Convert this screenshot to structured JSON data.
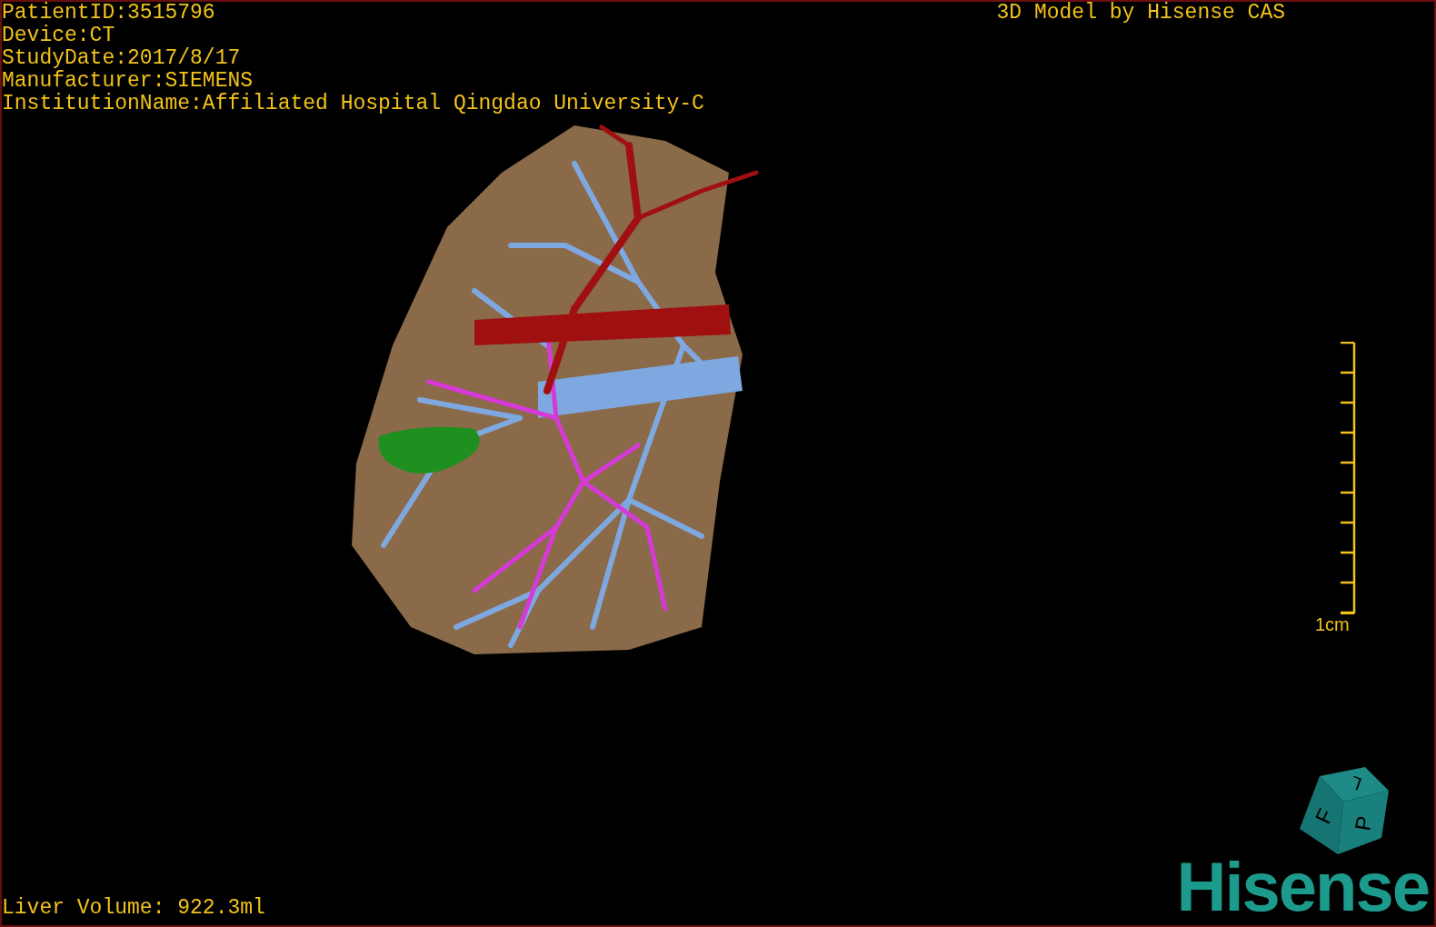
{
  "info_lines": [
    "PatientID:3515796",
    "Device:CT",
    "StudyDate:2017/8/17",
    "Manufacturer:SIEMENS",
    "InstitutionName:Affiliated Hospital Qingdao University-C"
  ],
  "title": "3D Model by Hisense CAS",
  "scale_bar": {
    "label": "1cm"
  },
  "orientation_cube": {
    "faces": [
      "F",
      "L",
      "P"
    ]
  },
  "logo": "Hisense",
  "liver_volume": "Liver Volume: 922.3ml"
}
